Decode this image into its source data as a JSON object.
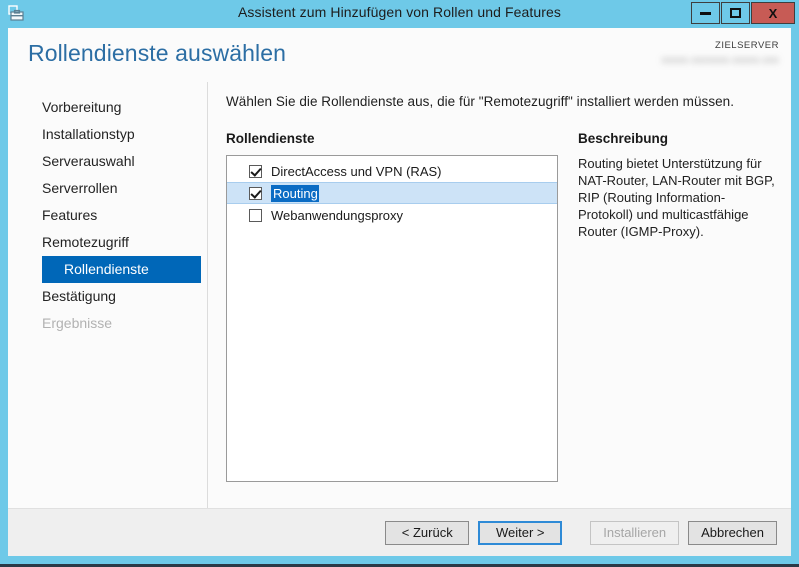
{
  "window": {
    "title": "Assistent zum Hinzufügen von Rollen und Features",
    "icon": "server-wizard-icon",
    "controls": {
      "minimize": "minimize-icon",
      "maximize": "maximize-icon",
      "close_label": "X"
    },
    "accent_color": "#6ec9e8",
    "close_color": "#c75b55"
  },
  "header": {
    "page_title": "Rollendienste auswählen",
    "target_server_label": "ZIELSERVER",
    "target_server_name": "xxxxx.xxxxxxx.xxxxx.xxx",
    "title_color": "#2c6ea4"
  },
  "sidebar": {
    "items": [
      {
        "label": "Vorbereitung",
        "state": "normal",
        "sub": false
      },
      {
        "label": "Installationstyp",
        "state": "normal",
        "sub": false
      },
      {
        "label": "Serverauswahl",
        "state": "normal",
        "sub": false
      },
      {
        "label": "Serverrollen",
        "state": "normal",
        "sub": false
      },
      {
        "label": "Features",
        "state": "normal",
        "sub": false
      },
      {
        "label": "Remotezugriff",
        "state": "normal",
        "sub": false
      },
      {
        "label": "Rollendienste",
        "state": "active",
        "sub": true
      },
      {
        "label": "Bestätigung",
        "state": "normal",
        "sub": false
      },
      {
        "label": "Ergebnisse",
        "state": "disabled",
        "sub": false
      }
    ],
    "active_color": "#0067b8"
  },
  "main": {
    "instruction": "Wählen Sie die Rollendienste aus, die für \"Remotezugriff\" installiert werden müssen.",
    "role_services_heading": "Rollendienste",
    "description_heading": "Beschreibung",
    "description_body": "Routing bietet Unterstützung für NAT-Router, LAN-Router mit BGP, RIP (Routing Information-Protokoll) und multicastfähige Router (IGMP-Proxy).",
    "role_services": [
      {
        "label": "DirectAccess und VPN (RAS)",
        "checked": true,
        "selected": false
      },
      {
        "label": "Routing",
        "checked": true,
        "selected": true
      },
      {
        "label": "Webanwendungsproxy",
        "checked": false,
        "selected": false
      }
    ],
    "selection_color": "#0b6cc4",
    "row_highlight_color": "#cde3f7"
  },
  "footer": {
    "buttons": [
      {
        "label": "< Zurück",
        "state": "normal"
      },
      {
        "label": "Weiter >",
        "state": "focused"
      },
      {
        "label": "Installieren",
        "state": "disabled"
      },
      {
        "label": "Abbrechen",
        "state": "normal"
      }
    ]
  }
}
